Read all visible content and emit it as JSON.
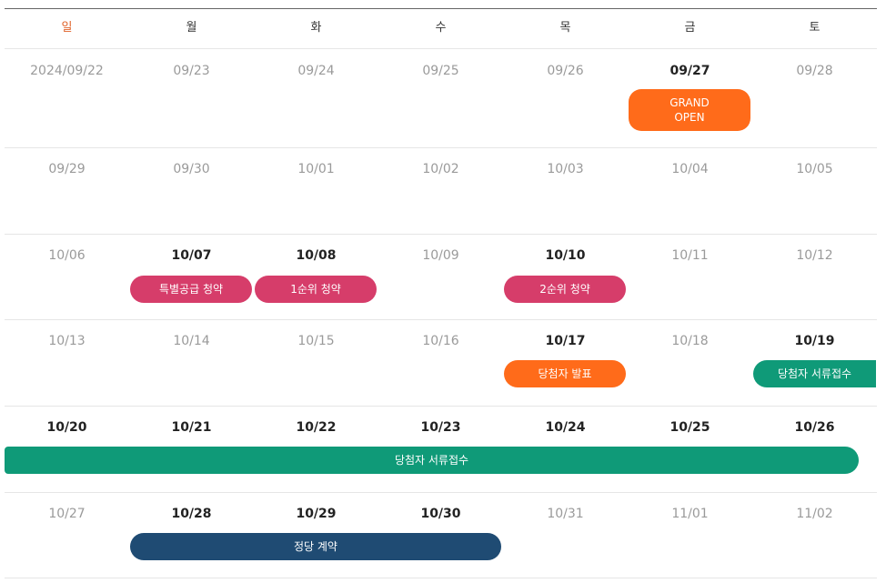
{
  "weekdays": [
    "일",
    "월",
    "화",
    "수",
    "목",
    "금",
    "토"
  ],
  "weeks": [
    {
      "days": [
        {
          "date": "2024/09/22",
          "active": false
        },
        {
          "date": "09/23",
          "active": false
        },
        {
          "date": "09/24",
          "active": false
        },
        {
          "date": "09/25",
          "active": false
        },
        {
          "date": "09/26",
          "active": false
        },
        {
          "date": "09/27",
          "active": true
        },
        {
          "date": "09/28",
          "active": false
        }
      ],
      "events": [
        {
          "label": "GRAND\nOPEN",
          "color": "orange",
          "start": 5,
          "span": 1,
          "tall": true
        }
      ]
    },
    {
      "days": [
        {
          "date": "09/29",
          "active": false
        },
        {
          "date": "09/30",
          "active": false
        },
        {
          "date": "10/01",
          "active": false
        },
        {
          "date": "10/02",
          "active": false
        },
        {
          "date": "10/03",
          "active": false
        },
        {
          "date": "10/04",
          "active": false
        },
        {
          "date": "10/05",
          "active": false
        }
      ],
      "events": []
    },
    {
      "days": [
        {
          "date": "10/06",
          "active": false
        },
        {
          "date": "10/07",
          "active": true
        },
        {
          "date": "10/08",
          "active": true
        },
        {
          "date": "10/09",
          "active": false
        },
        {
          "date": "10/10",
          "active": true
        },
        {
          "date": "10/11",
          "active": false
        },
        {
          "date": "10/12",
          "active": false
        }
      ],
      "events": [
        {
          "label": "특별공급 청약",
          "color": "pink",
          "start": 1,
          "span": 1
        },
        {
          "label": "1순위 청약",
          "color": "pink",
          "start": 2,
          "span": 1
        },
        {
          "label": "2순위 청약",
          "color": "pink",
          "start": 4,
          "span": 1
        }
      ]
    },
    {
      "days": [
        {
          "date": "10/13",
          "active": false
        },
        {
          "date": "10/14",
          "active": false
        },
        {
          "date": "10/15",
          "active": false
        },
        {
          "date": "10/16",
          "active": false
        },
        {
          "date": "10/17",
          "active": true
        },
        {
          "date": "10/18",
          "active": false
        },
        {
          "date": "10/19",
          "active": true
        }
      ],
      "events": [
        {
          "label": "당첨자 발표",
          "color": "orange",
          "start": 4,
          "span": 1
        },
        {
          "label": "당첨자 서류접수",
          "color": "green",
          "start": 6,
          "span": 1,
          "openRight": true
        }
      ]
    },
    {
      "days": [
        {
          "date": "10/20",
          "active": true
        },
        {
          "date": "10/21",
          "active": true
        },
        {
          "date": "10/22",
          "active": true
        },
        {
          "date": "10/23",
          "active": true
        },
        {
          "date": "10/24",
          "active": true
        },
        {
          "date": "10/25",
          "active": true
        },
        {
          "date": "10/26",
          "active": true
        }
      ],
      "events": [
        {
          "label": "당첨자 서류접수",
          "color": "green",
          "start": 0,
          "span": 7,
          "openLeft": true
        }
      ]
    },
    {
      "days": [
        {
          "date": "10/27",
          "active": false
        },
        {
          "date": "10/28",
          "active": true
        },
        {
          "date": "10/29",
          "active": true
        },
        {
          "date": "10/30",
          "active": true
        },
        {
          "date": "10/31",
          "active": false
        },
        {
          "date": "11/01",
          "active": false
        },
        {
          "date": "11/02",
          "active": false
        }
      ],
      "events": [
        {
          "label": "정당 계약",
          "color": "navy",
          "start": 1,
          "span": 3
        }
      ]
    }
  ]
}
